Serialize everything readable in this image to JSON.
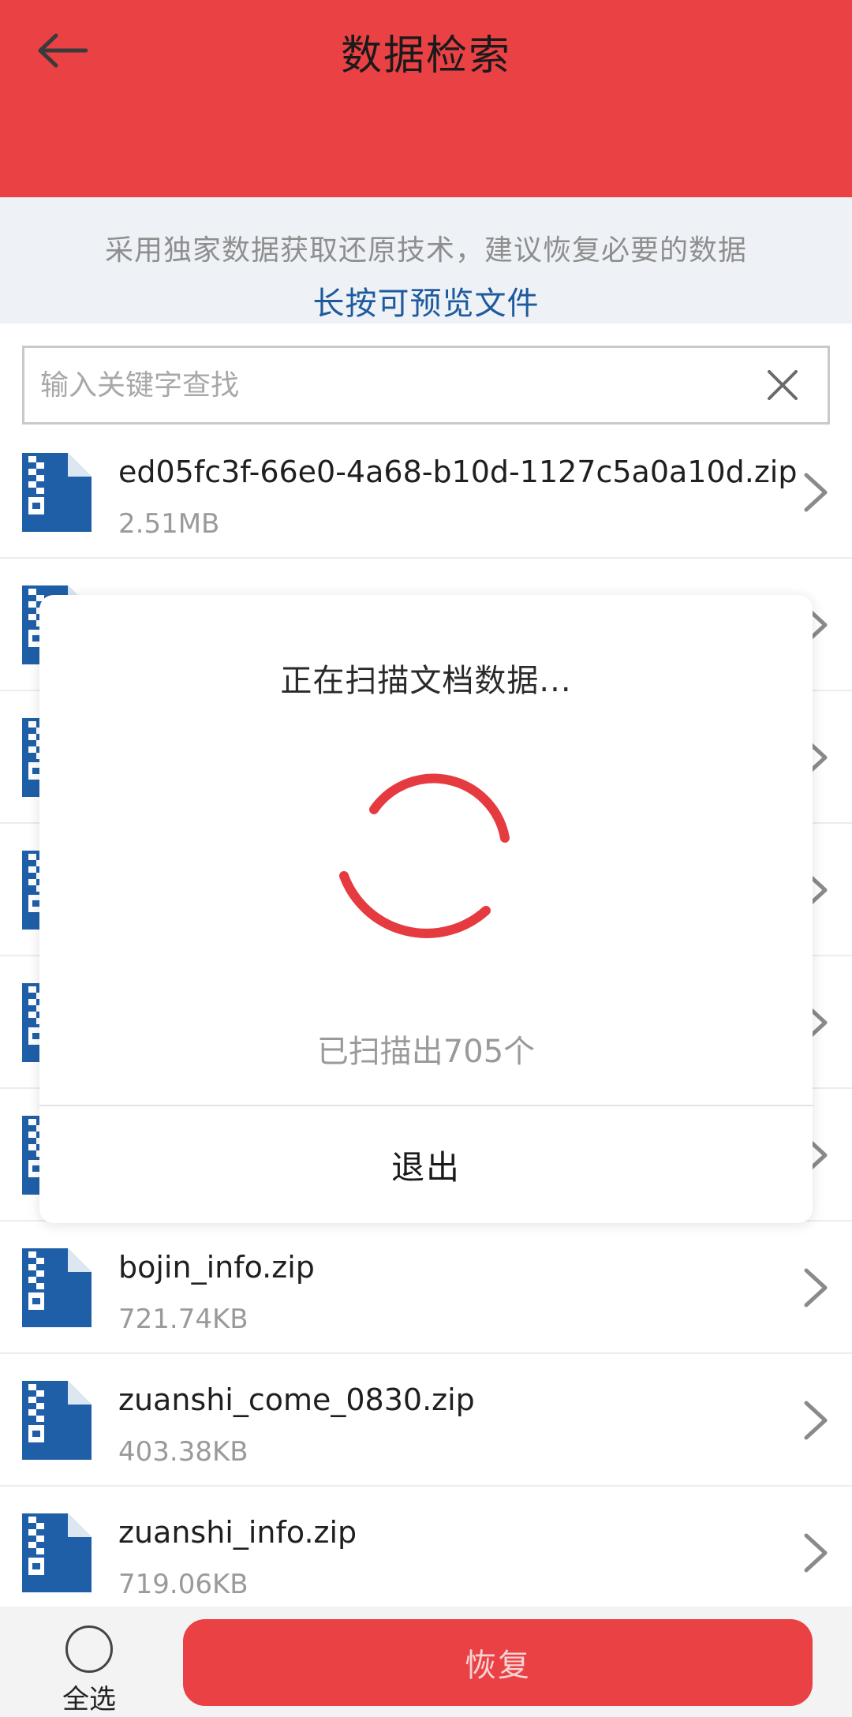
{
  "header": {
    "title": "数据检索",
    "back_icon": "arrow-left-icon"
  },
  "notice": {
    "line1": "采用独家数据获取还原技术，建议恢复必要的数据",
    "line2": "长按可预览文件"
  },
  "search": {
    "placeholder": "输入关键字查找",
    "value": "",
    "clear_icon": "close-icon"
  },
  "files": [
    {
      "name": "ed05fc3f-66e0-4a68-b10d-1127c5a0a10d.zip",
      "size": "2.51MB"
    },
    {
      "name": "",
      "size": ""
    },
    {
      "name": "",
      "size": ""
    },
    {
      "name": "",
      "size": ""
    },
    {
      "name": "",
      "size": ""
    },
    {
      "name": "",
      "size": ""
    },
    {
      "name": "bojin_info.zip",
      "size": "721.74KB"
    },
    {
      "name": "zuanshi_come_0830.zip",
      "size": "403.38KB"
    },
    {
      "name": "zuanshi_info.zip",
      "size": "719.06KB"
    }
  ],
  "bottom": {
    "select_all": "全选",
    "restore": "恢复"
  },
  "modal": {
    "title": "正在扫描文档数据...",
    "count": "已扫描出705个",
    "exit": "退出"
  },
  "colors": {
    "accent_red": "#ea4145",
    "file_icon_blue": "#1f5fa8",
    "notice_blue": "#1f5a9d"
  }
}
